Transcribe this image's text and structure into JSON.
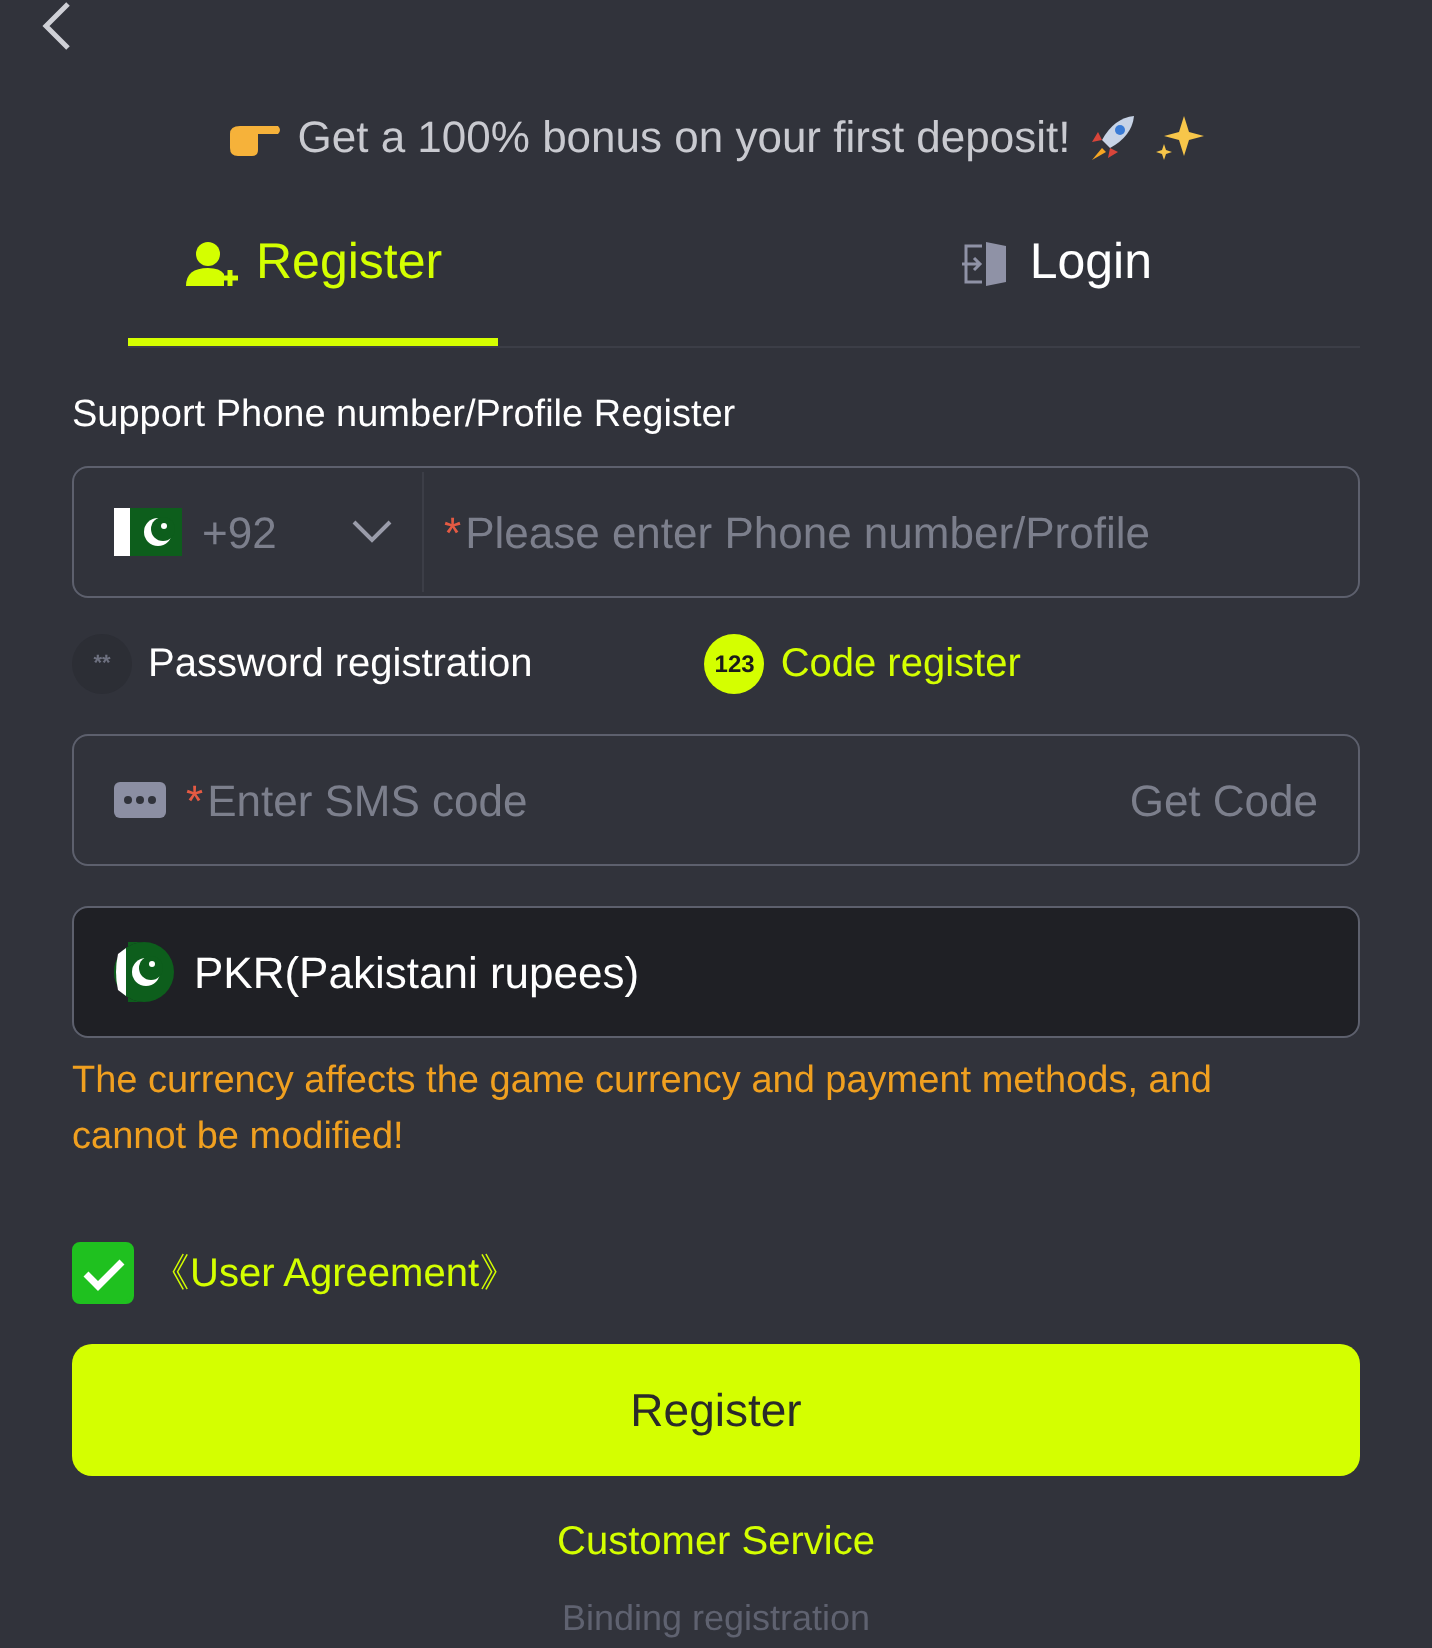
{
  "promo": "Get a 100% bonus on your first deposit!",
  "tabs": [
    {
      "label": "Register",
      "kind": "register",
      "selected": true
    },
    {
      "label": "Login",
      "kind": "login",
      "selected": false
    }
  ],
  "form_title": "Support Phone number/Profile Register",
  "phone": {
    "country_code": "+92",
    "required_mark": "*",
    "placeholder": "Please enter Phone number/Profile"
  },
  "modes": [
    {
      "label": "Password registration",
      "icon_text": "**",
      "selected": false
    },
    {
      "label": "Code register",
      "icon_text": "123",
      "selected": true
    }
  ],
  "sms": {
    "required_mark": "*",
    "placeholder": "Enter SMS code",
    "action": "Get Code"
  },
  "currency": {
    "value": "PKR(Pakistani rupees)"
  },
  "currency_notice": "The currency affects the game currency and payment methods, and cannot be modified!",
  "agreement": {
    "label": "《User Agreement》",
    "checked": true
  },
  "submit": "Register",
  "links": [
    "Customer Service",
    "Binding registration"
  ]
}
